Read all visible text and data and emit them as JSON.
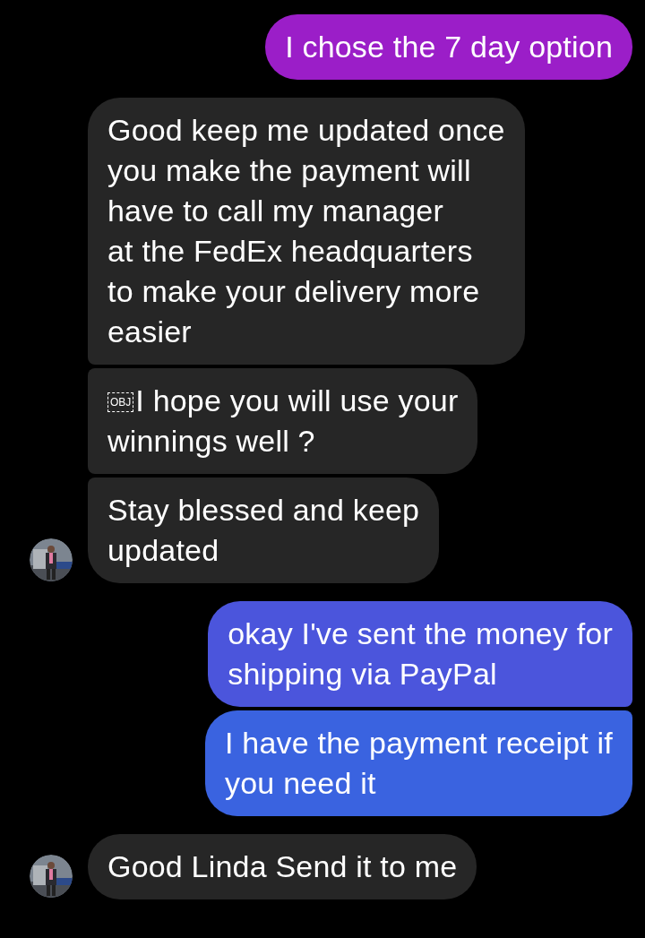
{
  "messages": [
    {
      "kind": "sent",
      "text": "I chose the 7 day option",
      "color": "#9b1ec8"
    },
    {
      "kind": "received",
      "text": "Good keep me updated once\nyou make the payment will\nhave to call my manager\nat the FedEx headquarters\nto make your delivery more\neasier",
      "avatar": false
    },
    {
      "kind": "received",
      "object_label": "OBJ",
      "text": "I hope you will use your\nwinnings well ?",
      "avatar": false
    },
    {
      "kind": "received",
      "text": "Stay blessed and keep\nupdated",
      "avatar": true
    },
    {
      "kind": "sent",
      "text": "okay I've sent the money for\nshipping via PayPal",
      "color": "#4b55dc"
    },
    {
      "kind": "sent",
      "text": "I have the payment receipt if\nyou need it",
      "color": "#3a63e0"
    },
    {
      "kind": "received",
      "text": "Good Linda Send it to me",
      "avatar": true
    }
  ]
}
